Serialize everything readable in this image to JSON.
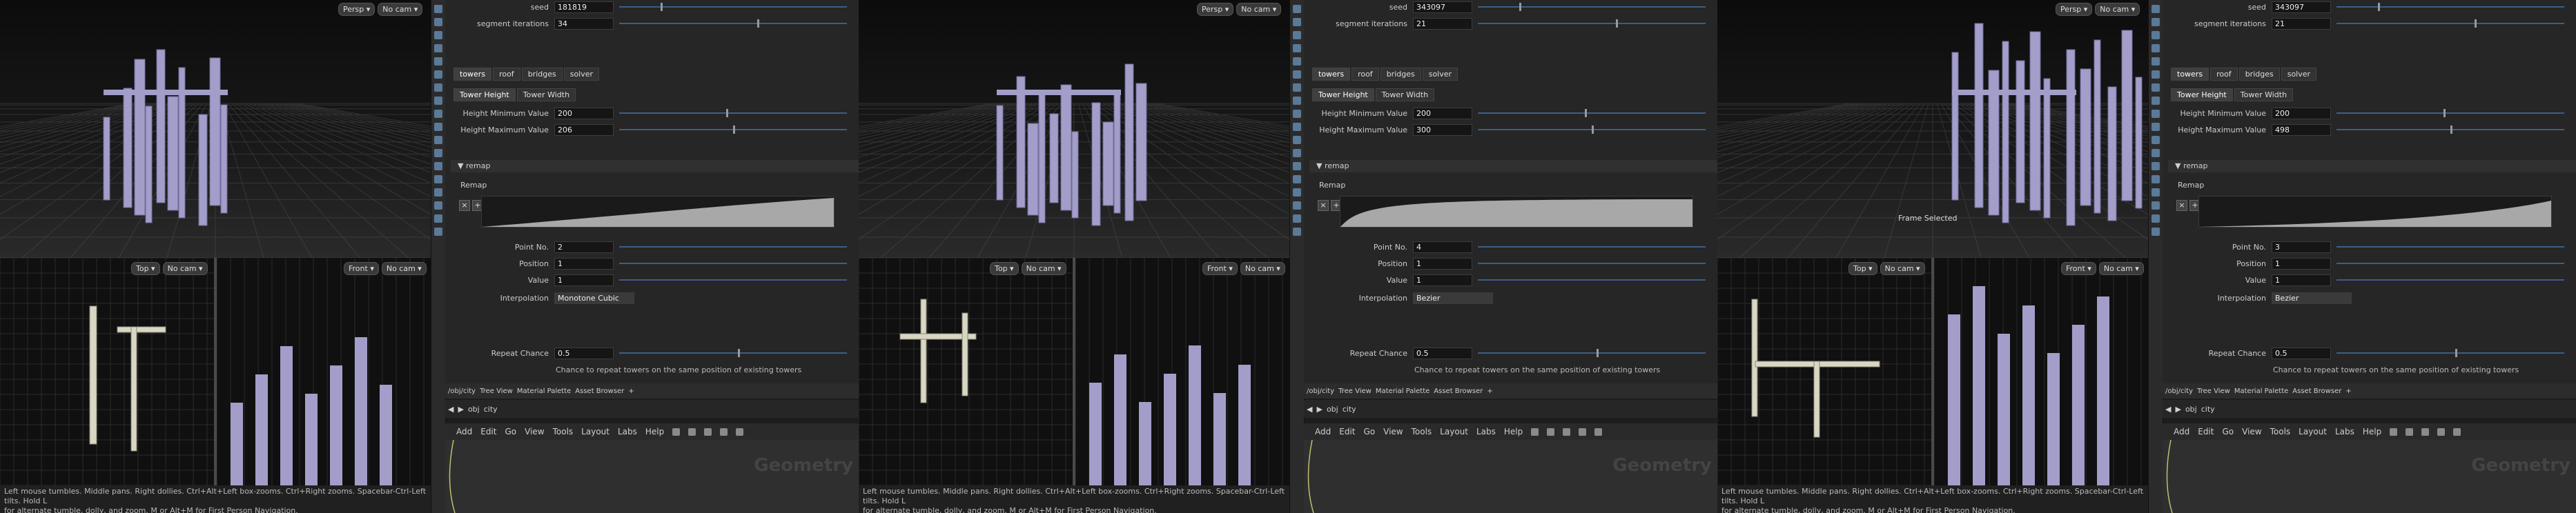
{
  "panels": [
    {
      "view_top": {
        "persp": "Persp ▾",
        "cam": "No cam ▾"
      },
      "view_left": {
        "label": "Top ▾",
        "cam": "No cam ▾"
      },
      "view_right": {
        "label": "Front ▾",
        "cam": "No cam ▾"
      },
      "params": {
        "seed_label": "seed",
        "seed": "181819",
        "segment_label": "segment iterations",
        "segment": "34",
        "height_min": "200",
        "height_max": "206",
        "point_no": "2",
        "position": "1",
        "value": "1",
        "interpolation": "Monotone Cubic",
        "repeat_chance": "0.5"
      },
      "status_line1": "Left mouse tumbles. Middle pans. Right dollies. Ctrl+Alt+Left box-zooms. Ctrl+Right zooms. Spacebar-Ctrl-Left tilts. Hold L",
      "status_line2": "for alternate tumble, dolly, and zoom.    M or Alt+M for First Person Navigation.",
      "overlay": ""
    },
    {
      "view_top": {
        "persp": "Persp ▾",
        "cam": "No cam ▾"
      },
      "view_left": {
        "label": "Top ▾",
        "cam": "No cam ▾"
      },
      "view_right": {
        "label": "Front ▾",
        "cam": "No cam ▾"
      },
      "params": {
        "seed_label": "seed",
        "seed": "343097",
        "segment_label": "segment iterations",
        "segment": "21",
        "height_min": "200",
        "height_max": "300",
        "point_no": "4",
        "position": "1",
        "value": "1",
        "interpolation": "Bezier",
        "repeat_chance": "0.5"
      },
      "status_line1": "Left mouse tumbles. Middle pans. Right dollies. Ctrl+Alt+Left box-zooms. Ctrl+Right zooms. Spacebar-Ctrl-Left tilts. Hold L",
      "status_line2": "for alternate tumble, dolly, and zoom.    M or Alt+M for First Person Navigation.",
      "overlay": ""
    },
    {
      "view_top": {
        "persp": "Persp ▾",
        "cam": "No cam ▾"
      },
      "view_left": {
        "label": "Top ▾",
        "cam": "No cam ▾"
      },
      "view_right": {
        "label": "Front ▾",
        "cam": "No cam ▾"
      },
      "params": {
        "seed_label": "seed",
        "seed": "343097",
        "segment_label": "segment iterations",
        "segment": "21",
        "height_min": "200",
        "height_max": "498",
        "point_no": "3",
        "position": "1",
        "value": "1",
        "interpolation": "Bezier",
        "repeat_chance": "0.5"
      },
      "status_line1": "Left mouse tumbles. Middle pans. Right dollies. Ctrl+Alt+Left box-zooms. Ctrl+Right zooms. Spacebar-Ctrl-Left tilts. Hold L",
      "status_line2": "for alternate tumble, dolly, and zoom.    M or Alt+M for First Person Navigation.",
      "overlay": "Frame Selected"
    }
  ],
  "common": {
    "tabs": [
      "towers",
      "roof",
      "bridges",
      "solver"
    ],
    "subtabs": [
      "Tower Height",
      "Tower Width"
    ],
    "height_min_label": "Height Minimum Value",
    "height_max_label": "Height Maximum Value",
    "section_remap": "remap",
    "remap_label": "Remap",
    "point_no_label": "Point No.",
    "position_label": "Position",
    "value_label": "Value",
    "interpolation_label": "Interpolation",
    "repeat_label": "Repeat Chance",
    "repeat_desc": "Chance to repeat towers on the same position of existing towers",
    "net_tabs": [
      "/obj/city",
      "Tree View",
      "Material Palette",
      "Asset Browser",
      "+"
    ],
    "path_obj": "obj",
    "path_city": "city",
    "menu": [
      "Add",
      "Edit",
      "Go",
      "View",
      "Tools",
      "Layout",
      "Labs",
      "Help"
    ],
    "network_ghost": "Geometry"
  },
  "colors": {
    "towers": "#a29ec9",
    "accent": "#3b5f87"
  }
}
